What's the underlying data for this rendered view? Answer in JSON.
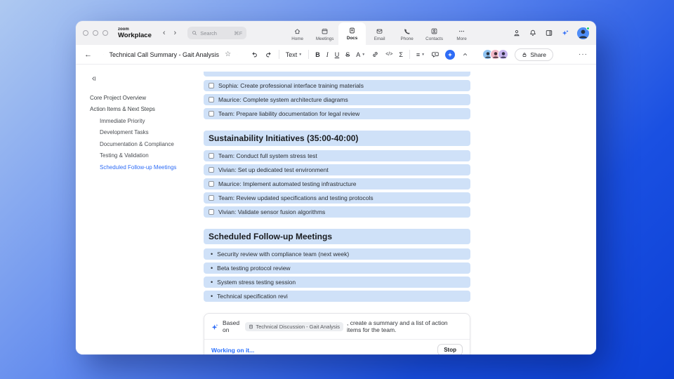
{
  "colors": {
    "accent_blue": "#2e6cf6",
    "row_highlight": "#cfe1f8",
    "active_link": "#2e6cf6",
    "status_green": "#17c964",
    "background_gradient_start": "#aec9f1",
    "background_gradient_end": "#0c40d5"
  },
  "titlebar": {
    "logo": {
      "top": "zoom",
      "bottom": "Workplace"
    },
    "search": {
      "placeholder": "Search",
      "shortcut": "⌘F"
    },
    "nav": [
      {
        "label": "Home"
      },
      {
        "label": "Meetings"
      },
      {
        "label": "Docs"
      },
      {
        "label": "Email"
      },
      {
        "label": "Phone"
      },
      {
        "label": "Contacts"
      },
      {
        "label": "More"
      }
    ]
  },
  "doc_toolbar": {
    "title": "Technical Call Summary - Gait Analysis",
    "text_style_label": "Text",
    "share_label": "Share"
  },
  "sidebar": {
    "items": [
      {
        "label": "Core Project Overview"
      },
      {
        "label": "Action Items & Next Steps"
      },
      {
        "label": "Immediate Priority"
      },
      {
        "label": "Development Tasks"
      },
      {
        "label": "Documentation & Compliance"
      },
      {
        "label": "Testing & Validation"
      },
      {
        "label": "Scheduled Follow-up Meetings"
      }
    ]
  },
  "document": {
    "top_tasks": [
      "Sophia: Create professional interface training materials",
      "Maurice: Complete system architecture diagrams",
      "Team: Prepare liability documentation for legal review"
    ],
    "sections": [
      {
        "heading": "Sustainability Initiatives (35:00-40:00)",
        "tasks": [
          "Team: Conduct full system stress test",
          "Vivian: Set up dedicated test environment",
          "Maurice: Implement automated testing infrastructure",
          "Team: Review updated specifications and testing protocols",
          "Vivian: Validate sensor fusion algorithms"
        ]
      },
      {
        "heading": "Scheduled Follow-up Meetings",
        "bullets": [
          "Security review with compliance team (next week)",
          "Beta testing protocol review",
          "System stress testing session",
          "Technical specification revi"
        ]
      }
    ]
  },
  "ai_panel": {
    "prefix": "Based on",
    "source_chip": "Technical Discussion - Gait Analysis",
    "suffix": ", create a summary and a list of action items for the team.",
    "status": "Working on it...",
    "stop_label": "Stop"
  }
}
